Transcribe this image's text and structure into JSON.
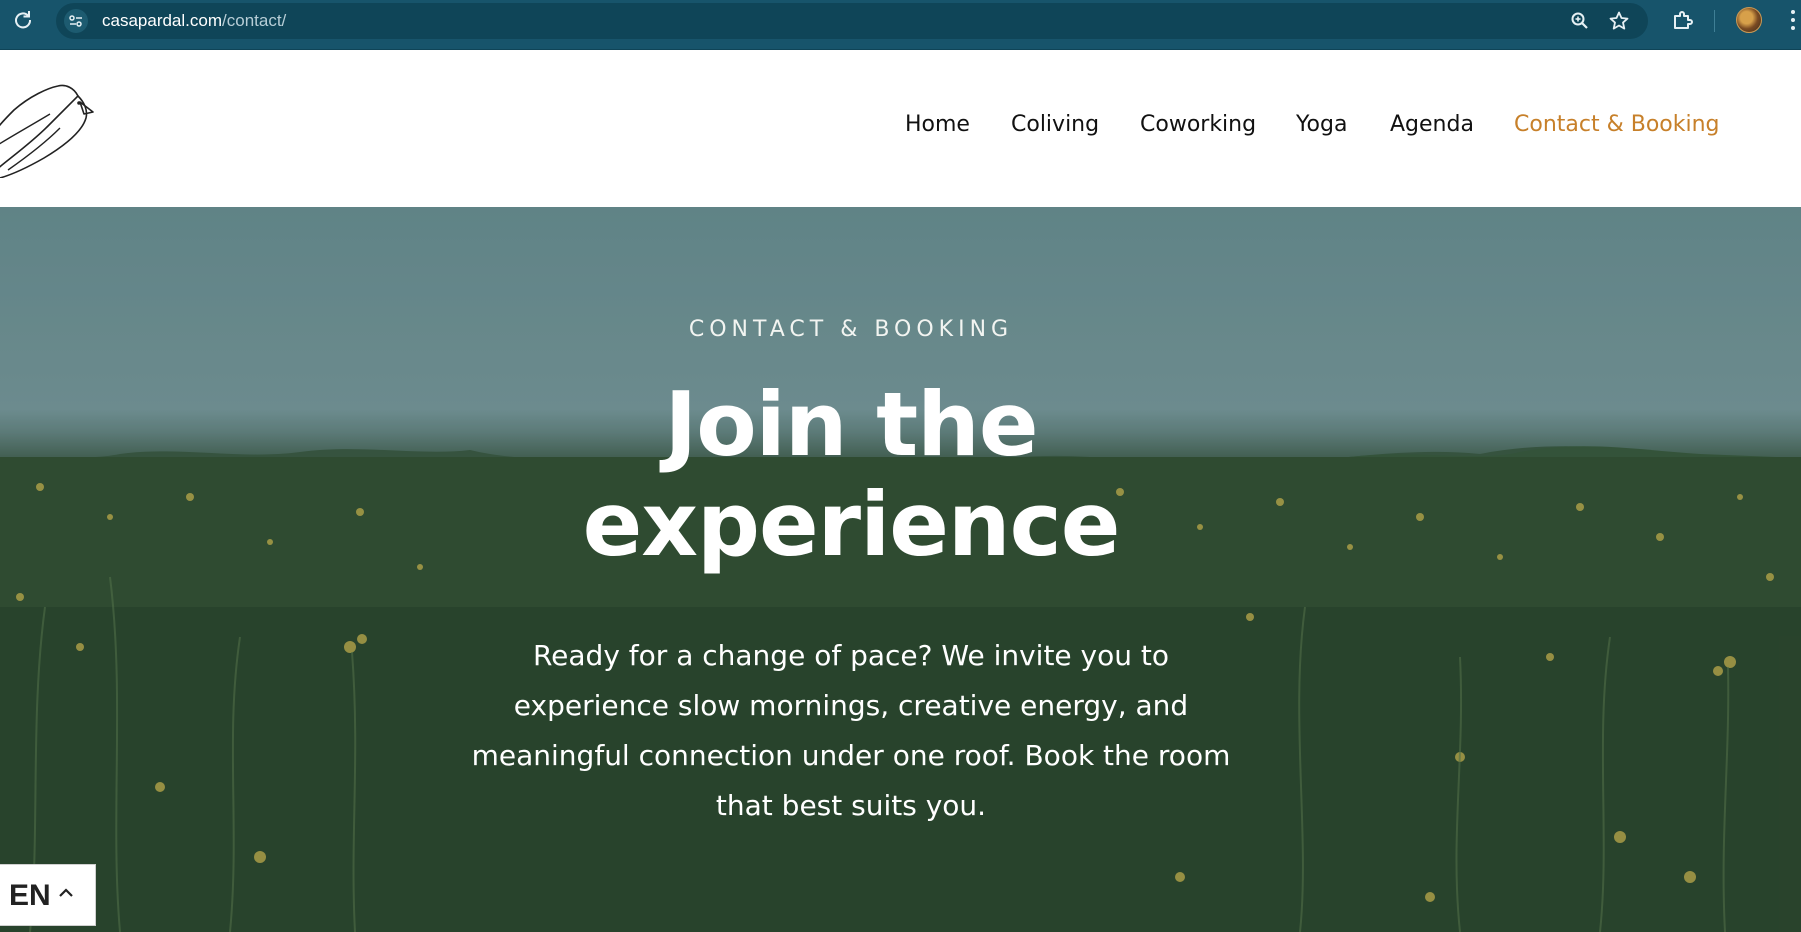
{
  "browser": {
    "url_host": "casapardal.com",
    "url_path": "/contact/",
    "icons": [
      "reload-icon",
      "site-info-icon",
      "zoom-icon",
      "bookmark-star-icon",
      "extensions-icon",
      "profile-avatar",
      "menu-dots-icon"
    ]
  },
  "header": {
    "logo": "bird-logo",
    "nav": [
      {
        "label": "Home"
      },
      {
        "label": "Coliving"
      },
      {
        "label": "Coworking"
      },
      {
        "label": "Yoga"
      },
      {
        "label": "Agenda"
      },
      {
        "label": "Contact & Booking",
        "active": true
      }
    ],
    "active_color": "#c7802a"
  },
  "hero": {
    "kicker": "CONTACT & BOOKING",
    "headline_line1": "Join the",
    "headline_line2": "experience",
    "lede": "Ready for a change of pace? We invite you to experience slow mornings, creative energy, and meaningful connection under one roof. Book the room that best suits you."
  },
  "language_switcher": {
    "code": "EN",
    "icon": "chevron-up-icon"
  }
}
